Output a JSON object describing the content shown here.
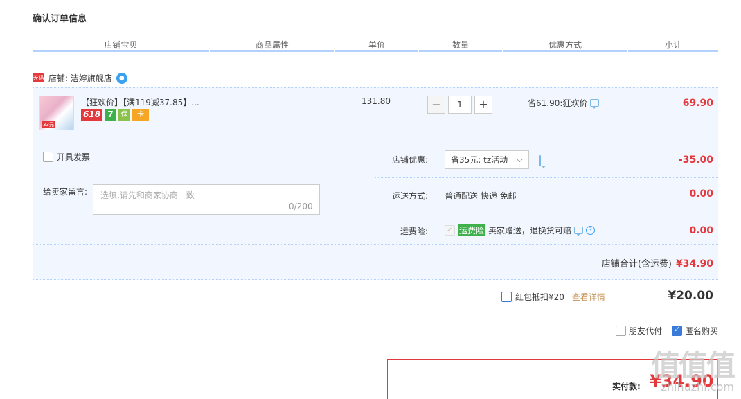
{
  "page_title": "确认订单信息",
  "columns": [
    "店铺宝贝",
    "商品属性",
    "单价",
    "数量",
    "优惠方式",
    "小计"
  ],
  "shop": {
    "tmall_tag": "天猫",
    "label": "店铺: 洁婷旗舰店"
  },
  "item": {
    "title": "【狂欢价】【满119减37.85】...",
    "thumb_tag": "33元",
    "badges": {
      "b618": "618",
      "b7": "7",
      "guard": "保",
      "card": "卡"
    },
    "unit_price": "131.80",
    "qty_minus": "−",
    "qty": "1",
    "qty_plus": "+",
    "promo": "省61.90:狂欢价",
    "subtotal": "69.90"
  },
  "invoice_label": "开具发票",
  "message": {
    "label": "给卖家留言:",
    "placeholder": "选填,请先和商家协商一致",
    "count": "0/200"
  },
  "shop_discount": {
    "label": "店铺优惠:",
    "selected": "省35元: tz活动",
    "amount": "-35.00"
  },
  "shipping": {
    "label": "运送方式:",
    "value": "普通配送 快递 免邮",
    "amount": "0.00"
  },
  "freight_insurance": {
    "label": "运费险:",
    "tag": "运费险",
    "text": "卖家赠送，退换货可赔",
    "help": "?",
    "amount": "0.00"
  },
  "shop_total": {
    "label": "店铺合计(含运费)",
    "value": "¥34.90"
  },
  "hongbao": {
    "label": "红包抵扣¥20",
    "detail": "查看详情",
    "amount": "¥20.00"
  },
  "options": {
    "friend_pay": "朋友代付",
    "anonymous": "匿名购买"
  },
  "payment": {
    "label": "实付款:",
    "amount": "¥34.90"
  },
  "watermark": {
    "main": "值值值",
    "sub": "zhihuzhi.com"
  }
}
